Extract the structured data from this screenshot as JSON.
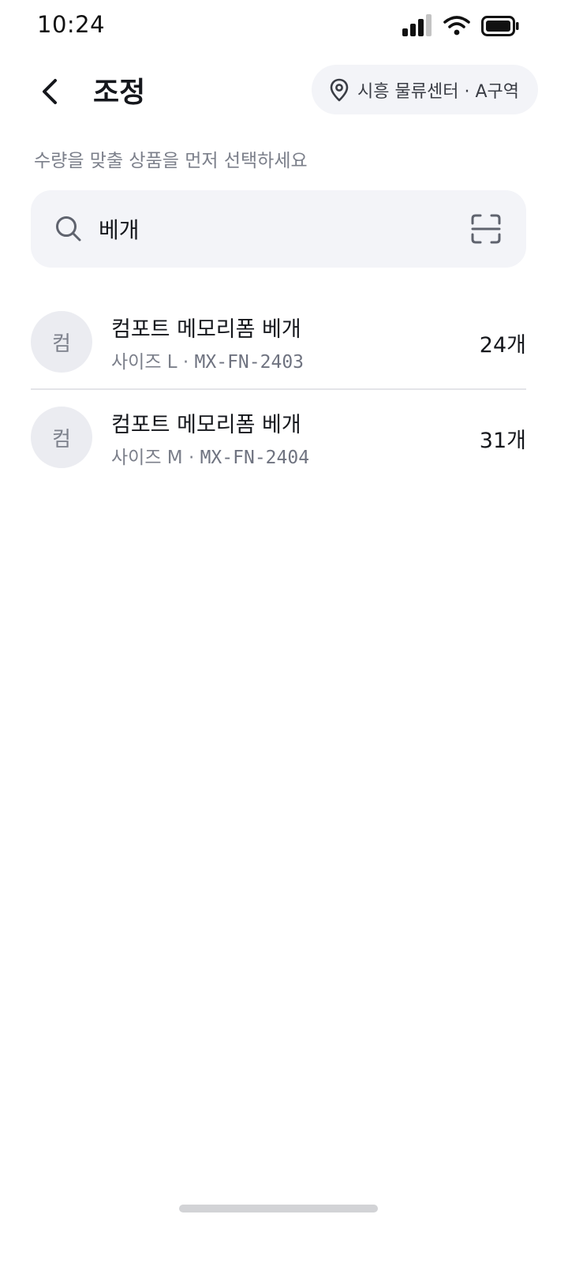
{
  "status_bar": {
    "time": "10:24",
    "icons": [
      "signal-icon",
      "wifi-icon",
      "battery-icon"
    ]
  },
  "header": {
    "title": "조정",
    "back_icon": "chevron-left-icon",
    "location": {
      "icon": "map-pin-icon",
      "label": "시흥 물류센터 · A구역"
    }
  },
  "instruction": "수량을 맞출 상품을 먼저 선택하세요",
  "search": {
    "value": "베개",
    "placeholder": "",
    "search_icon": "search-icon",
    "scan_icon": "scan-icon"
  },
  "products": [
    {
      "avatar": "컴",
      "name": "컴포트 메모리폼 베개",
      "size": "사이즈 L · ",
      "sku": "MX-FN-2403",
      "qty": "24개"
    },
    {
      "avatar": "컴",
      "name": "컴포트 메모리폼 베개",
      "size": "사이즈 M · ",
      "sku": "MX-FN-2404",
      "qty": "31개"
    }
  ],
  "colors": {
    "text_primary": "#15171c",
    "text_secondary": "#7b7f8a",
    "surface": "#f3f4f8",
    "avatar_bg": "#ebecf1",
    "divider": "#e3e4e8"
  }
}
